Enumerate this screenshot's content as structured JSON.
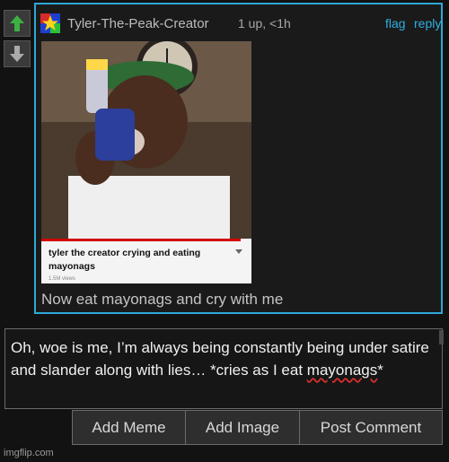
{
  "comment": {
    "username": "Tyler-The-Peak-Creator",
    "meta": "1 up, <1h",
    "flag_label": "flag",
    "reply_label": "reply",
    "caption": "Now eat mayonags and cry with me",
    "embedded_video": {
      "title": "tyler the creator crying and eating mayonags",
      "views": "1.5M views",
      "progress": 0.95
    }
  },
  "reply_box": {
    "text_part1": "Oh, woe is me, I’m always being constantly being under satire and slander along with lies… *cries as I eat ",
    "misspelled_word": "mayonags",
    "text_part2": "*"
  },
  "buttons": {
    "add_meme": "Add Meme",
    "add_image": "Add Image",
    "post_comment": "Post Comment"
  },
  "watermark": "imgflip.com",
  "colors": {
    "accent": "#2fa8d8",
    "link": "#2fb0e0",
    "upvote": "#3cb043"
  }
}
